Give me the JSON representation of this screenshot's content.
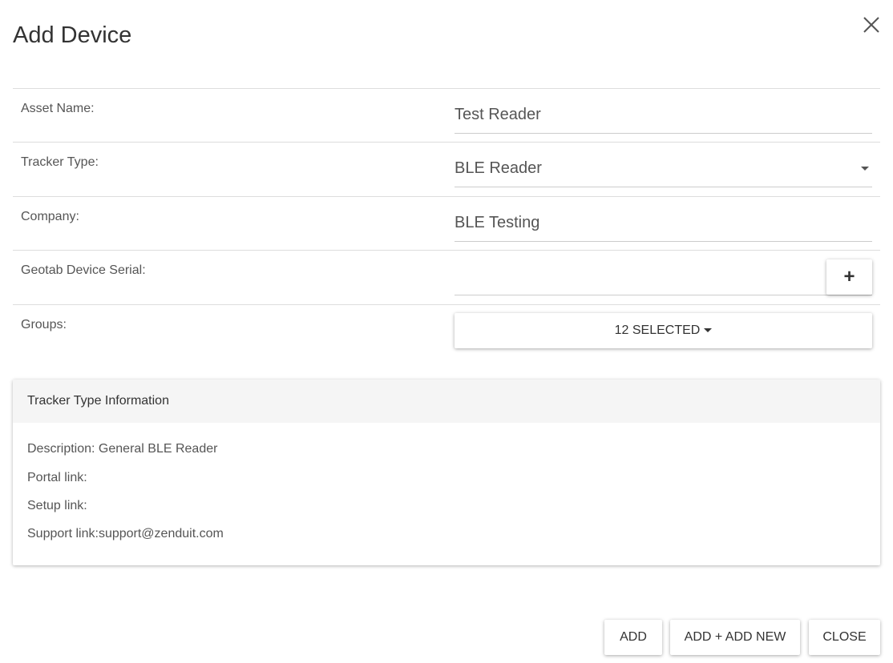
{
  "dialog": {
    "title": "Add Device"
  },
  "form": {
    "asset_name": {
      "label": "Asset Name:",
      "value": "Test Reader"
    },
    "tracker_type": {
      "label": "Tracker Type:",
      "value": "BLE Reader"
    },
    "company": {
      "label": "Company:",
      "value": "BLE Testing"
    },
    "geotab_serial": {
      "label": "Geotab Device Serial:",
      "value": "",
      "add_label": "+"
    },
    "groups": {
      "label": "Groups:",
      "value": "12 SELECTED"
    }
  },
  "info_panel": {
    "title": "Tracker Type Information",
    "description": "Description: General BLE Reader",
    "portal_link": "Portal link:",
    "setup_link": "Setup link:",
    "support_link": "Support link:support@zenduit.com"
  },
  "footer": {
    "add_label": "ADD",
    "add_new_label": "ADD + ADD NEW",
    "close_label": "CLOSE"
  },
  "icons": {
    "close": "close-icon",
    "dropdown": "caret-down-icon",
    "plus": "plus-icon"
  }
}
